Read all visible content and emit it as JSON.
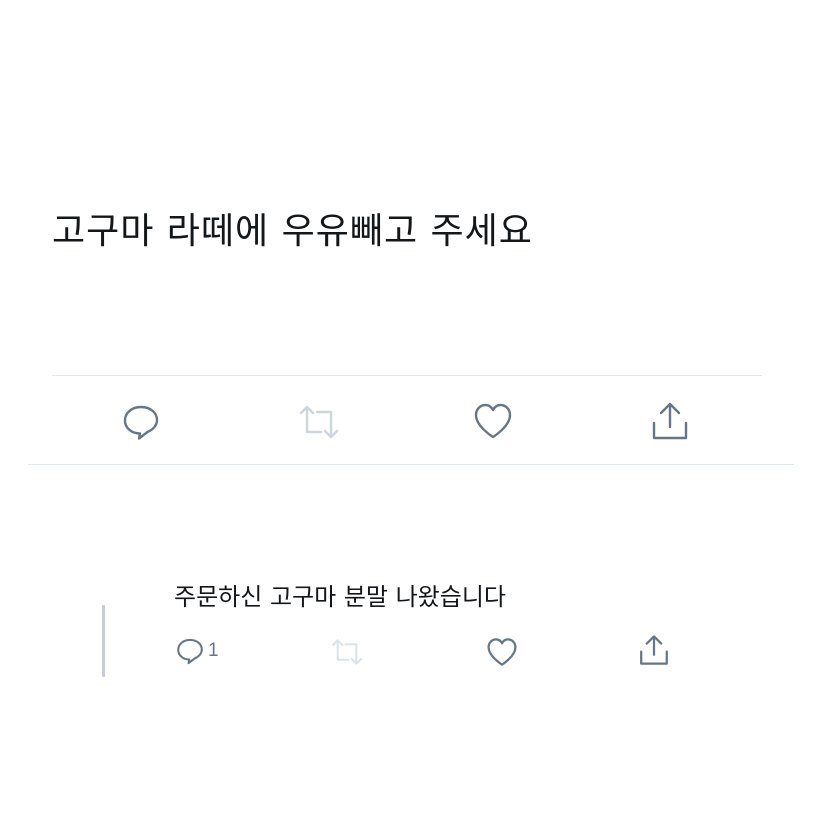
{
  "tweet": {
    "text": "고구마 라떼에 우유빼고 주세요",
    "actions": {
      "reply_icon": "reply-speech-bubble-icon",
      "retweet_icon": "retweet-arrows-icon",
      "like_icon": "heart-icon",
      "share_icon": "share-upload-icon",
      "retweet_disabled": true
    }
  },
  "reply": {
    "text": "주문하신 고구마 분말 나왔습니다",
    "reply_count": "1",
    "actions": {
      "reply_icon": "reply-speech-bubble-icon",
      "retweet_icon": "retweet-arrows-icon",
      "like_icon": "heart-icon",
      "share_icon": "share-upload-icon",
      "retweet_disabled": true
    }
  },
  "colors": {
    "text": "#14171a",
    "icon": "#657786",
    "icon_disabled": "#ccd6dd",
    "divider": "#e1e8ed",
    "thread_line": "#c7cdd2"
  }
}
